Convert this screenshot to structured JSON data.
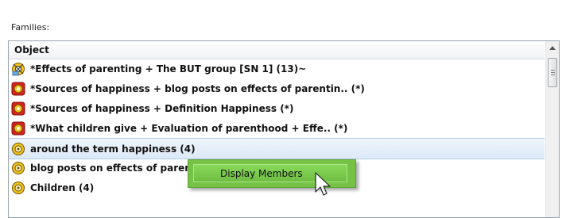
{
  "panel": {
    "label": "Families:",
    "column_header": "Object",
    "rows": [
      {
        "icon": "network-family-icon",
        "label": "*Effects of parenting + The BUT group [SN 1] (13)~"
      },
      {
        "icon": "red-family-icon",
        "label": "*Sources of happiness + blog posts on effects of parentin.. (*)"
      },
      {
        "icon": "red-family-icon",
        "label": "*Sources of happiness + Definition Happiness (*)"
      },
      {
        "icon": "red-family-icon",
        "label": "*What children give + Evaluation of parenthood + Effe.. (*)"
      },
      {
        "icon": "yellow-family-icon",
        "label": "around the term happiness (4)",
        "selected": true
      },
      {
        "icon": "yellow-family-icon",
        "label": "blog posts on effects of parenting (4)"
      },
      {
        "icon": "yellow-family-icon",
        "label": "Children (4)"
      }
    ]
  },
  "context_menu": {
    "items": [
      {
        "label": "Display Members"
      }
    ]
  },
  "colors": {
    "menu_green": "#76c247",
    "selection": "#dde9f7",
    "red_icon": "#d9231b",
    "yellow_icon": "#f0c419"
  }
}
